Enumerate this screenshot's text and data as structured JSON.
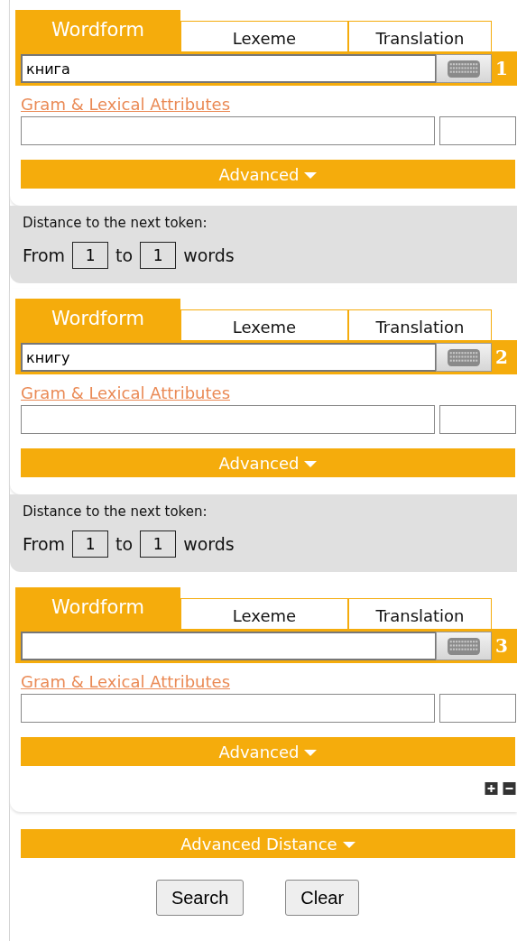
{
  "tokens": [
    {
      "tabs": [
        {
          "label": "Wordform",
          "selected": true
        },
        {
          "label": "Lexeme",
          "selected": false
        },
        {
          "label": "Translation",
          "selected": false
        }
      ],
      "value": "книга",
      "number": "1",
      "attributes_link": "Gram & Lexical Attributes",
      "advanced": "Advanced",
      "distance": {
        "title": "Distance to the next token:",
        "from_label": "From",
        "from": "1",
        "to_label": "to",
        "to": "1",
        "unit": "words"
      }
    },
    {
      "tabs": [
        {
          "label": "Wordform",
          "selected": true
        },
        {
          "label": "Lexeme",
          "selected": false
        },
        {
          "label": "Translation",
          "selected": false
        }
      ],
      "value": "книгу",
      "number": "2",
      "attributes_link": "Gram & Lexical Attributes",
      "advanced": "Advanced",
      "distance": {
        "title": "Distance to the next token:",
        "from_label": "From",
        "from": "1",
        "to_label": "to",
        "to": "1",
        "unit": "words"
      }
    },
    {
      "tabs": [
        {
          "label": "Wordform",
          "selected": true
        },
        {
          "label": "Lexeme",
          "selected": false
        },
        {
          "label": "Translation",
          "selected": false
        }
      ],
      "number": "3",
      "attributes_link": "Gram & Lexical Attributes",
      "advanced": "Advanced",
      "add_remove": true
    }
  ],
  "advanced_distance": "Advanced Distance",
  "buttons": [
    {
      "label": "Search"
    },
    {
      "label": "Clear"
    }
  ]
}
